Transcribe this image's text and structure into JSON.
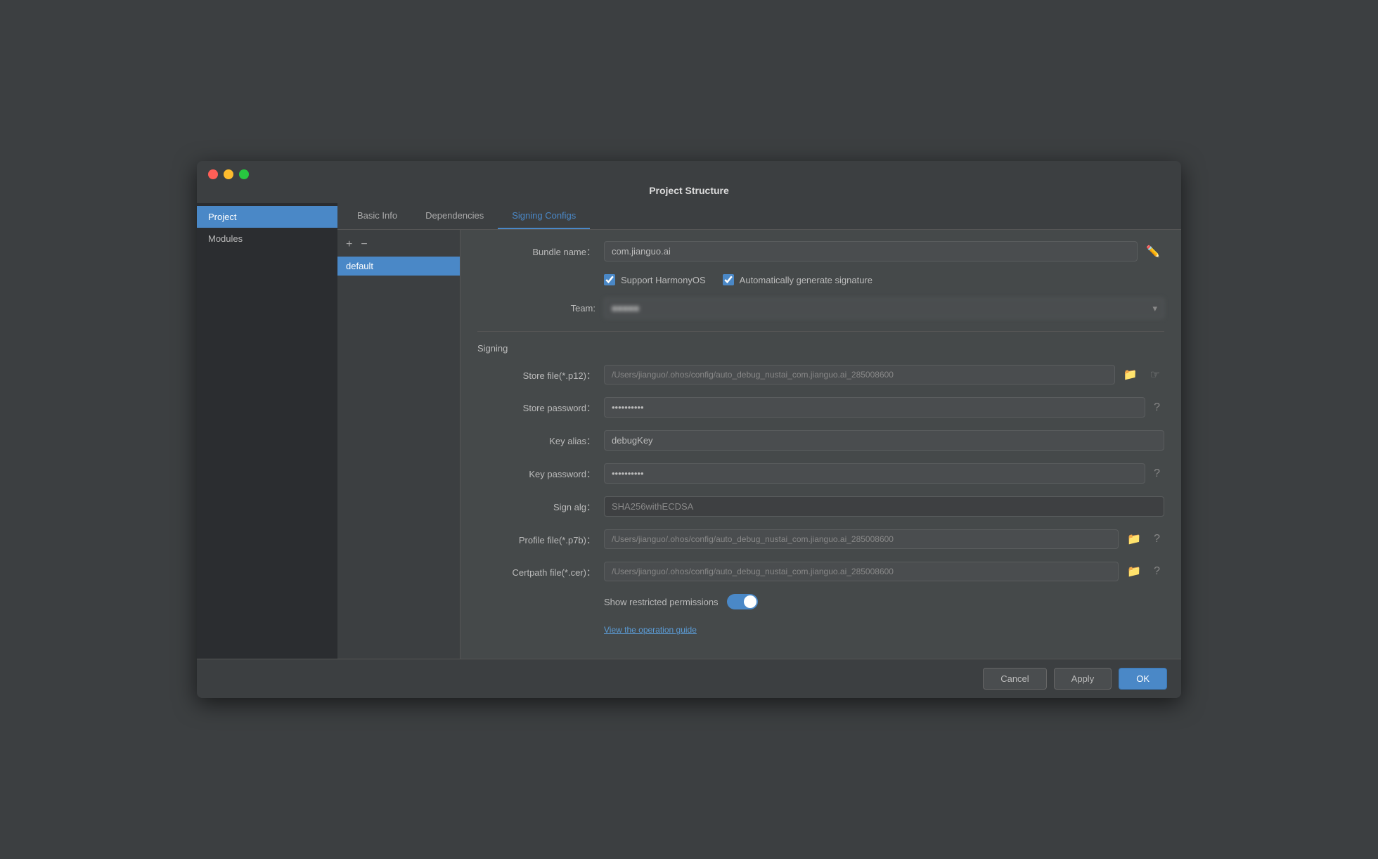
{
  "window": {
    "title": "Project Structure"
  },
  "sidebar": {
    "items": [
      {
        "label": "Project",
        "active": true
      },
      {
        "label": "Modules",
        "active": false
      }
    ]
  },
  "tabs": [
    {
      "label": "Basic Info",
      "active": false
    },
    {
      "label": "Dependencies",
      "active": false
    },
    {
      "label": "Signing Configs",
      "active": true
    }
  ],
  "config": {
    "toolbar": {
      "add_label": "+",
      "remove_label": "−"
    },
    "items": [
      {
        "label": "default",
        "active": true
      }
    ]
  },
  "form": {
    "bundle_name_label": "Bundle name：",
    "bundle_name_value": "com.jianguo.ai",
    "support_harmonyos_label": "Support HarmonyOS",
    "auto_sign_label": "Automatically generate signature",
    "team_label": "Team:",
    "team_value": "■■■■■",
    "signing_section_label": "Signing",
    "store_file_label": "Store file(*.p12)：",
    "store_file_value": "/Users/jianguo/.ohos/config/auto_debug_nustai_com.jianguo.ai_285008600",
    "store_password_label": "Store password：",
    "store_password_value": "••••••••••",
    "key_alias_label": "Key alias：",
    "key_alias_value": "debugKey",
    "key_password_label": "Key password：",
    "key_password_value": "••••••••••",
    "sign_alg_label": "Sign alg：",
    "sign_alg_value": "SHA256withECDSA",
    "profile_file_label": "Profile file(*.p7b)：",
    "profile_file_value": "/Users/jianguo/.ohos/config/auto_debug_nustai_com.jianguo.ai_285008600",
    "certpath_file_label": "Certpath file(*.cer)：",
    "certpath_file_value": "/Users/jianguo/.ohos/config/auto_debug_nustai_com.jianguo.ai_285008600",
    "show_restricted_label": "Show restricted permissions",
    "view_guide_label": "View the operation guide"
  },
  "footer": {
    "cancel_label": "Cancel",
    "apply_label": "Apply",
    "ok_label": "OK"
  }
}
